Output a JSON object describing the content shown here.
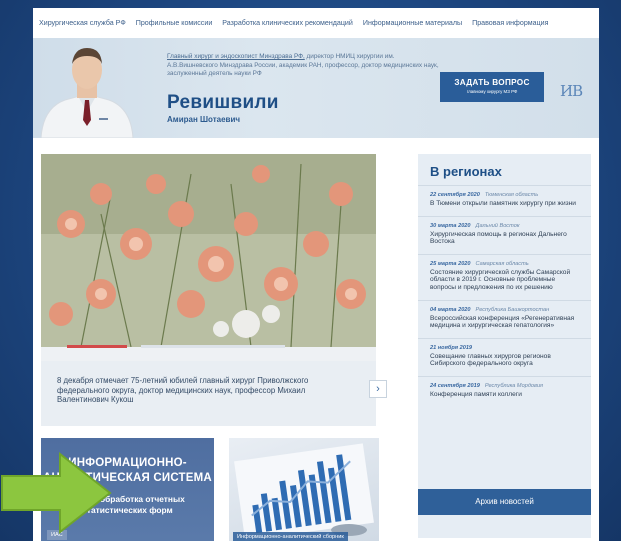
{
  "nav": {
    "items": [
      "Хирургическая служба РФ",
      "Профильные комиссии",
      "Разработка клинических рекомендаций",
      "Информационные материалы",
      "Правовая информация"
    ]
  },
  "hero": {
    "desc_link": "Главный хирург и эндоскопист Минздрава РФ,",
    "desc_rest": " директор НМИЦ хирургии им. А.В.Вишневского Минздрава России, академик РАН, профессор, доктор медицинских наук, заслуженный деятель науки РФ",
    "surname": "Ревишвили",
    "given": "Амиран Шотаевич",
    "ask_line1": "ЗАДАТЬ ВОПРОС",
    "ask_line2": "главному хирургу МЗ РФ",
    "logo": "ИВ"
  },
  "slider": {
    "caption": "8 декабря отмечает 75-летний юбилей главный хирург Приволжского федерального округа, доктор медицинских наук, профессор Михаил Валентинович Кукош",
    "next_icon": "›"
  },
  "regions": {
    "title": "В регионах",
    "items": [
      {
        "date": "22 сентября 2020",
        "region": "Тюменская область",
        "text": "В Тюмени открыли памятник хирургу при жизни"
      },
      {
        "date": "30 марта 2020",
        "region": "Дальний Восток",
        "text": "Хирургическая помощь в регионах Дальнего Востока"
      },
      {
        "date": "25 марта 2020",
        "region": "Самарская область",
        "text": "Состояние хирургической службы Самарской области в 2019 г. Основные проблемные вопросы и предложения по их решению"
      },
      {
        "date": "04 марта 2020",
        "region": "Республика Башкортостан",
        "text": "Всероссийская конференция «Регенеративная медицина и хирургическая гепатология»"
      },
      {
        "date": "21 ноября 2019",
        "region": "",
        "text": "Совещание главных хирургов регионов Сибирского федерального округа"
      },
      {
        "date": "24 сентября 2019",
        "region": "Республика Мордовия",
        "text": "Конференция памяти коллеги"
      }
    ],
    "archive": "Архив новостей"
  },
  "cards": {
    "ias_title": "ИНФОРМАЦИОННО-АНАЛИТИЧЕСКАЯ СИСТЕМА",
    "ias_sub": "сбор и обработка отчетных статистических форм",
    "ias_tag": "ИАС",
    "sbornik_tag": "Информационно-аналитический сборник"
  },
  "colors": {
    "accent": "#2a5d99",
    "arrow": "#8cc63f",
    "indicator": "#d24a4a"
  }
}
